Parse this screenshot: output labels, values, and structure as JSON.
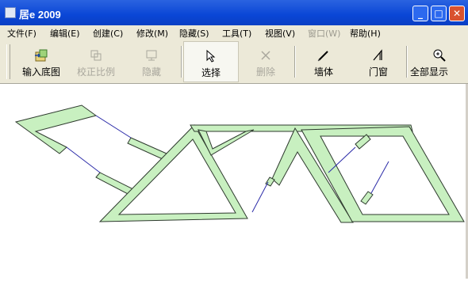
{
  "window": {
    "title": "居e 2009",
    "controls": {
      "minimize": "_",
      "maximize": "□",
      "close": "✕"
    }
  },
  "menu": [
    {
      "label": "文件(F)",
      "enabled": true
    },
    {
      "label": "编辑(E)",
      "enabled": true
    },
    {
      "label": "创建(C)",
      "enabled": true
    },
    {
      "label": "修改(M)",
      "enabled": true
    },
    {
      "label": "隐藏(S)",
      "enabled": true
    },
    {
      "label": "工具(T)",
      "enabled": true
    },
    {
      "label": "视图(V)",
      "enabled": true
    },
    {
      "label": "窗口(W)",
      "enabled": false
    },
    {
      "label": "帮助(H)",
      "enabled": true
    }
  ],
  "toolbar": [
    {
      "label": "输入底图",
      "icon": "import-image-icon",
      "enabled": true
    },
    {
      "label": "校正比例",
      "icon": "scale-calibrate-icon",
      "enabled": false
    },
    {
      "label": "隐藏",
      "icon": "hide-icon",
      "enabled": false
    },
    {
      "label": "选择",
      "icon": "select-cursor-icon",
      "enabled": true,
      "pressed": true
    },
    {
      "label": "删除",
      "icon": "delete-x-icon",
      "enabled": false
    },
    {
      "label": "墙体",
      "icon": "wall-pen-icon",
      "enabled": true
    },
    {
      "label": "门窗",
      "icon": "door-window-icon",
      "enabled": true
    },
    {
      "label": "全部显示",
      "icon": "zoom-all-icon",
      "enabled": true
    }
  ],
  "colors": {
    "wall_fill": "#c8f0c0",
    "wall_stroke": "#2e3a2e",
    "link_line": "#2a2aa8",
    "titlebar": "#0a46d6"
  }
}
